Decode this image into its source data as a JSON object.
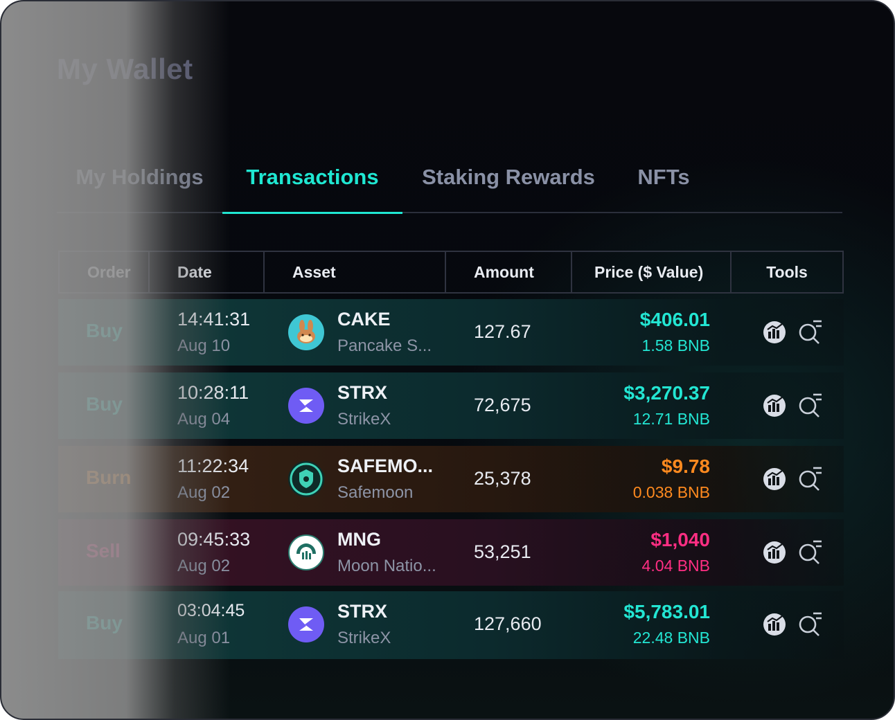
{
  "wallet": {
    "title": "My Wallet"
  },
  "tabs": [
    {
      "label": "My Holdings",
      "active": false
    },
    {
      "label": "Transactions",
      "active": true
    },
    {
      "label": "Staking Rewards",
      "active": false
    },
    {
      "label": "NFTs",
      "active": false
    }
  ],
  "table": {
    "headers": [
      "Order",
      "Date",
      "Asset",
      "Amount",
      "Price ($ Value)",
      "Tools"
    ],
    "rows": [
      {
        "order": "Buy",
        "time": "14:41:31",
        "date": "Aug 10",
        "symbol": "CAKE",
        "name": "Pancake S...",
        "amount": "127.67",
        "usd": "$406.01",
        "bnb": "1.58 BNB",
        "coin_icon": "pancake-bunny-icon"
      },
      {
        "order": "Buy",
        "time": "10:28:11",
        "date": "Aug 04",
        "symbol": "STRX",
        "name": "StrikeX",
        "amount": "72,675",
        "usd": "$3,270.37",
        "bnb": "12.71 BNB",
        "coin_icon": "strikex-icon"
      },
      {
        "order": "Burn",
        "time": "11:22:34",
        "date": "Aug 02",
        "symbol": "SAFEMO...",
        "name": "Safemoon",
        "amount": "25,378",
        "usd": "$9.78",
        "bnb": "0.038 BNB",
        "coin_icon": "safemoon-icon"
      },
      {
        "order": "Sell",
        "time": "09:45:33",
        "date": "Aug 02",
        "symbol": "MNG",
        "name": "Moon Natio...",
        "amount": "53,251",
        "usd": "$1,040",
        "bnb": "4.04 BNB",
        "coin_icon": "moon-nation-icon"
      },
      {
        "order": "Buy",
        "time": "03:04:45",
        "date": "Aug 01",
        "symbol": "STRX",
        "name": "StrikeX",
        "amount": "127,660",
        "usd": "$5,783.01",
        "bnb": "22.48 BNB",
        "coin_icon": "strikex-icon"
      }
    ]
  },
  "tools": {
    "chart_icon": "chart-icon",
    "search_icon": "search-list-icon"
  },
  "colors": {
    "accent": "#1fe7d2",
    "buy": "#23e6d3",
    "burn": "#ff8a1f",
    "sell": "#ff2e83",
    "cake_bg": "#3fc7d4",
    "strikex_bg": "#6f5cf4"
  }
}
